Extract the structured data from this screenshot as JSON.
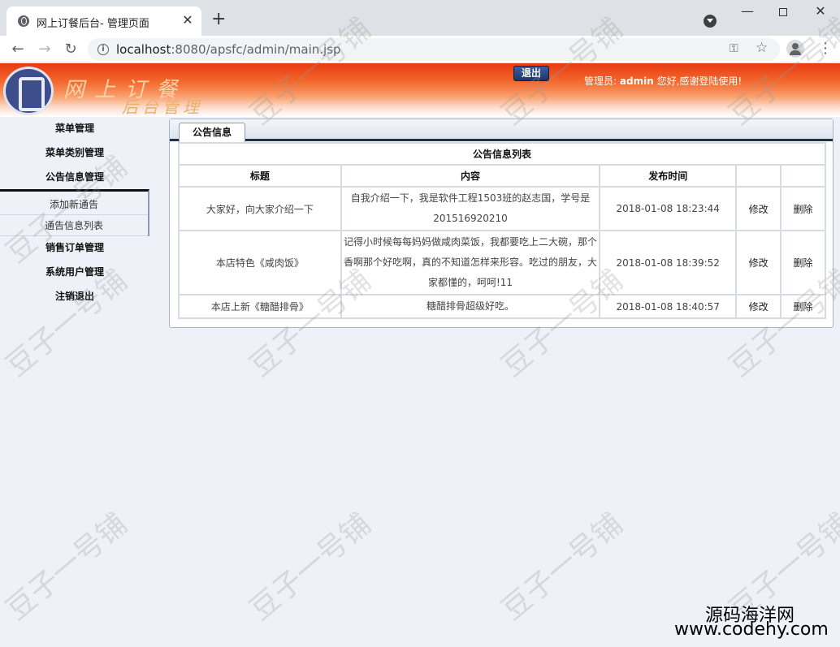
{
  "browser": {
    "tab_title": "网上订餐后台- 管理页面",
    "url_host": "localhost",
    "url_rest": ":8080/apsfc/admin/main.jsp"
  },
  "header": {
    "logo_line1": "网上订餐",
    "logo_line2": "后台管理",
    "logout_label": "退出",
    "admin_prefix": "管理员:",
    "admin_name": "admin",
    "admin_greeting": "您好,感谢登陆使用!"
  },
  "sidebar": {
    "items": [
      {
        "label": "菜单管理"
      },
      {
        "label": "菜单类别管理"
      },
      {
        "label": "公告信息管理"
      },
      {
        "label": "销售订单管理"
      },
      {
        "label": "系统用户管理"
      },
      {
        "label": "注销退出"
      }
    ],
    "sub_items": [
      {
        "label": "添加新通告"
      },
      {
        "label": "通告信息列表"
      }
    ]
  },
  "main": {
    "tab_label": "公告信息",
    "table_caption": "公告信息列表",
    "columns": [
      "标题",
      "内容",
      "发布时间",
      "",
      ""
    ],
    "rows": [
      {
        "title": "大家好，向大家介绍一下",
        "content": "自我介绍一下，我是软件工程1503班的赵志国，学号是201516920210",
        "time": "2018-01-08 18:23:44",
        "edit": "修改",
        "del": "删除"
      },
      {
        "title": "本店特色《咸肉饭》",
        "content": "记得小时候每每妈妈做咸肉菜饭，我都要吃上二大碗，那个香啊那个好吃啊，真的不知道怎样来形容。吃过的朋友，大家都懂的，呵呵!11",
        "time": "2018-01-08 18:39:52",
        "edit": "修改",
        "del": "删除"
      },
      {
        "title": "本店上新《糖醋排骨》",
        "content": "糖醋排骨超级好吃。",
        "time": "2018-01-08 18:40:57",
        "edit": "修改",
        "del": "删除"
      }
    ]
  },
  "watermark": {
    "text": "豆子一号铺",
    "brand_name": "源码海洋网",
    "brand_url": "www.codehy.com"
  },
  "colors": {
    "header_red": "#e83a12",
    "logout_blue": "#1d3565",
    "page_bg": "#eef1f8"
  }
}
